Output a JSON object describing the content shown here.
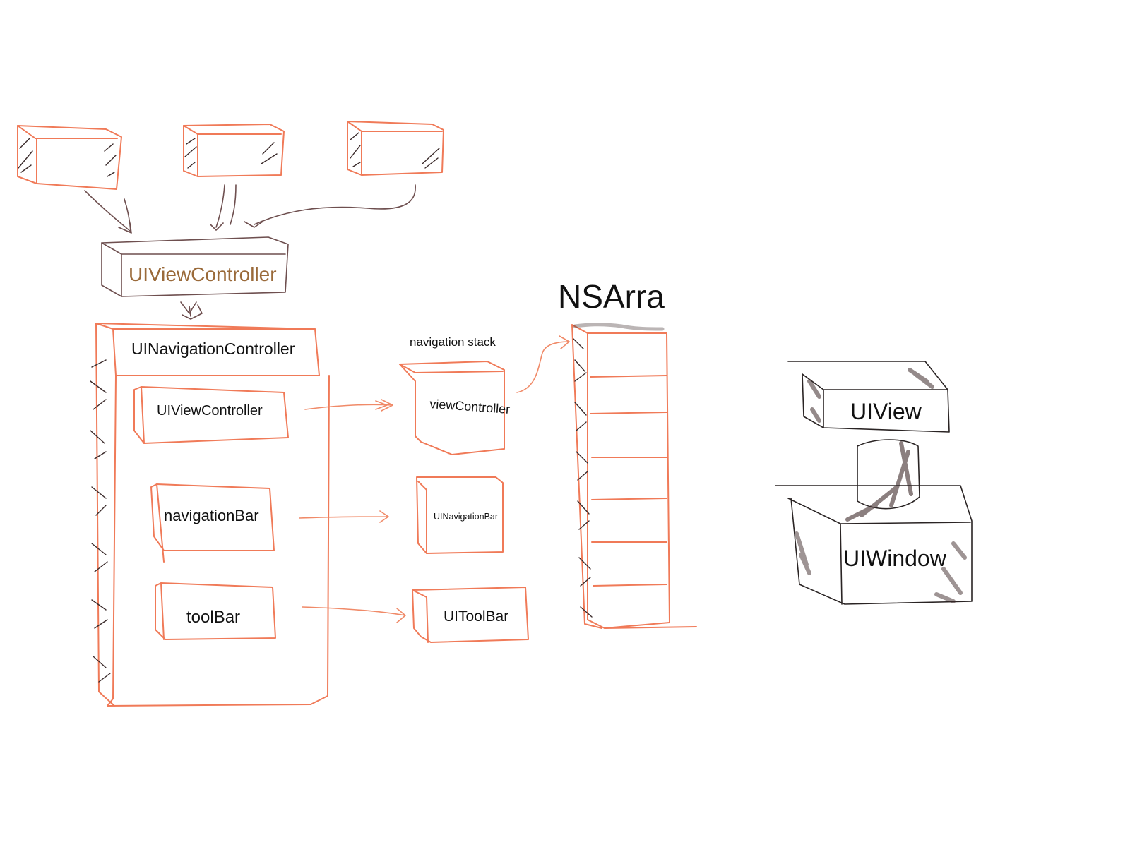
{
  "diagram": {
    "top_controller": {
      "label": "UIViewController",
      "color": "#9a6a3a"
    },
    "nav_controller": {
      "label": "UINavigationController",
      "children": [
        {
          "label": "UIViewController"
        },
        {
          "label": "navigationBar"
        },
        {
          "label": "toolBar"
        }
      ]
    },
    "stack": {
      "caption": "navigation stack",
      "items": [
        {
          "label": "viewController"
        },
        {
          "label": "UINavigationBar"
        },
        {
          "label": "UIToolBar"
        }
      ]
    },
    "array": {
      "label": "NSArra",
      "slots": 8
    },
    "view_hierarchy": {
      "view": {
        "label": "UIView"
      },
      "window": {
        "label": "UIWindow"
      }
    },
    "colors": {
      "accent": "#f07a58",
      "dark": "#2a2424",
      "title_brown": "#9a6a3a"
    }
  }
}
